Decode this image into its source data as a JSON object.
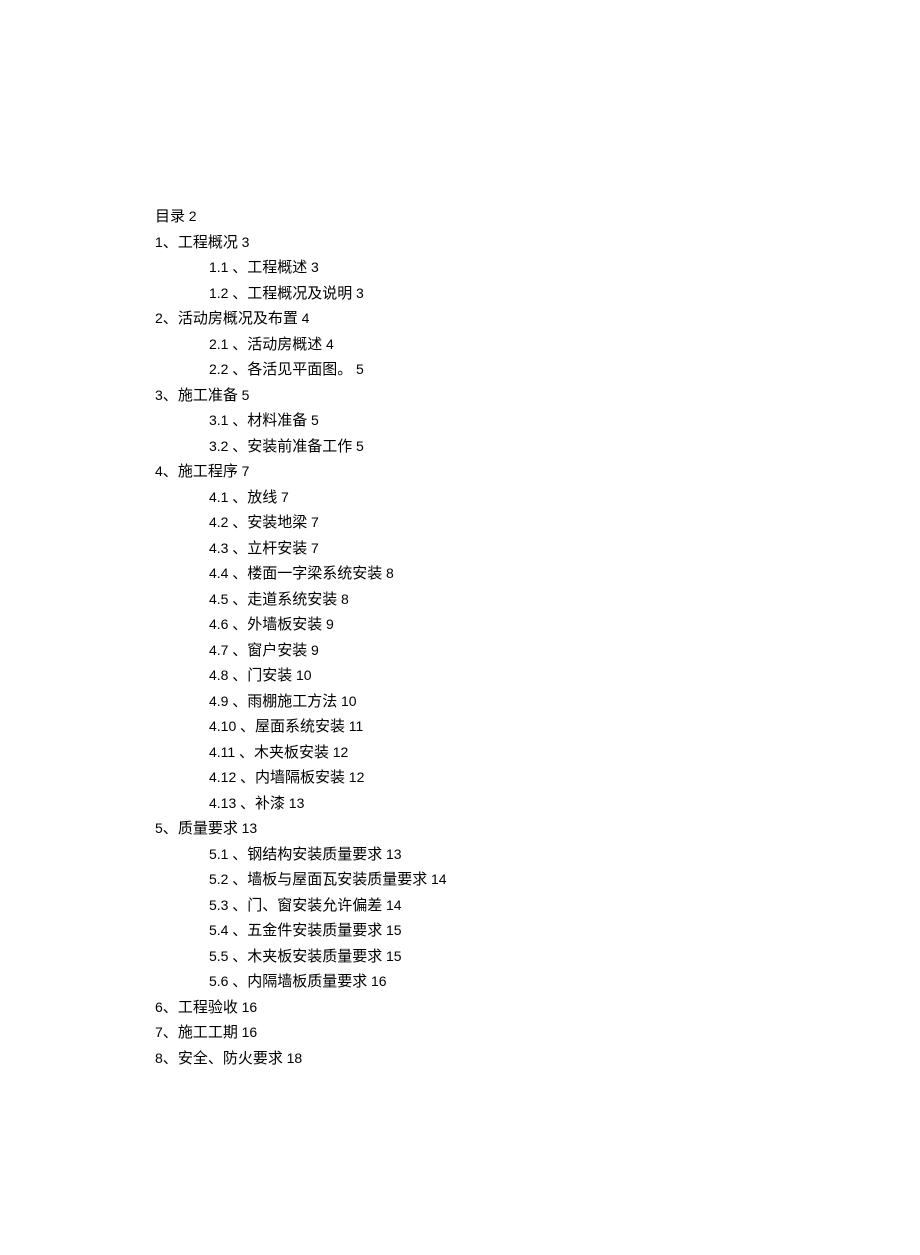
{
  "toc": {
    "title": {
      "text": "目录",
      "page": "2"
    },
    "sections": [
      {
        "num": "1",
        "title": "工程概况",
        "page": "3",
        "children": [
          {
            "num": "1.1",
            "title": "工程概述",
            "page": "3"
          },
          {
            "num": "1.2",
            "title": "工程概况及说明",
            "page": "3"
          }
        ]
      },
      {
        "num": "2",
        "title": "活动房概况及布置",
        "page": "4",
        "children": [
          {
            "num": "2.1",
            "title": "活动房概述",
            "page": "4"
          },
          {
            "num": "2.2",
            "title": "各活见平面图。",
            "page": "5"
          }
        ]
      },
      {
        "num": "3",
        "title": "施工准备",
        "page": "5",
        "children": [
          {
            "num": "3.1",
            "title": "材料准备",
            "page": "5"
          },
          {
            "num": "3.2",
            "title": "安装前准备工作",
            "page": "5"
          }
        ]
      },
      {
        "num": "4",
        "title": "施工程序",
        "page": "7",
        "children": [
          {
            "num": "4.1",
            "title": "放线",
            "page": "7"
          },
          {
            "num": "4.2",
            "title": "安装地梁",
            "page": "7"
          },
          {
            "num": "4.3",
            "title": "立杆安装",
            "page": "7"
          },
          {
            "num": "4.4",
            "title": "楼面一字梁系统安装",
            "page": "8"
          },
          {
            "num": "4.5",
            "title": "走道系统安装",
            "page": "8"
          },
          {
            "num": "4.6",
            "title": "外墙板安装",
            "page": "9"
          },
          {
            "num": "4.7",
            "title": "窗户安装",
            "page": "9"
          },
          {
            "num": "4.8",
            "title": "门安装",
            "page": "10"
          },
          {
            "num": "4.9",
            "title": "雨棚施工方法",
            "page": "10"
          },
          {
            "num": "4.10",
            "title": "屋面系统安装",
            "page": "11"
          },
          {
            "num": "4.11",
            "title": "木夹板安装",
            "page": "12"
          },
          {
            "num": "4.12",
            "title": "内墙隔板安装",
            "page": "12"
          },
          {
            "num": "4.13",
            "title": "补漆",
            "page": "13"
          }
        ]
      },
      {
        "num": "5",
        "title": "质量要求",
        "page": "13",
        "children": [
          {
            "num": "5.1",
            "title": "钢结构安装质量要求",
            "page": "13"
          },
          {
            "num": "5.2",
            "title": "墙板与屋面瓦安装质量要求",
            "page": "14"
          },
          {
            "num": "5.3",
            "title": "门、窗安装允许偏差",
            "page": "14"
          },
          {
            "num": "5.4",
            "title": "五金件安装质量要求",
            "page": "15"
          },
          {
            "num": "5.5",
            "title": "木夹板安装质量要求",
            "page": "15"
          },
          {
            "num": "5.6",
            "title": "内隔墙板质量要求",
            "page": "16"
          }
        ]
      },
      {
        "num": "6",
        "title": "工程验收",
        "page": "16",
        "children": []
      },
      {
        "num": "7",
        "title": "施工工期",
        "page": "16",
        "children": []
      },
      {
        "num": "8",
        "title": "安全、防火要求",
        "page": "18",
        "children": []
      }
    ]
  }
}
